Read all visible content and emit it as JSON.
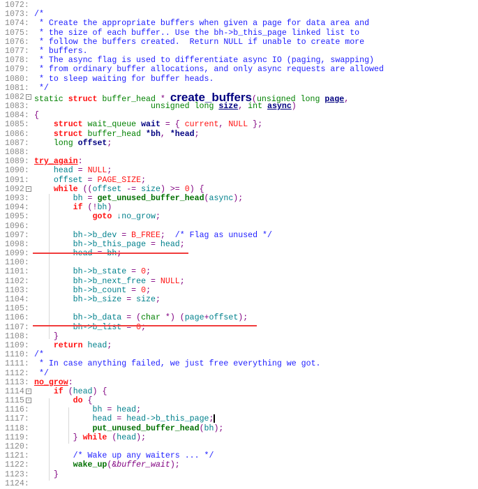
{
  "editor": {
    "fold_icon": "minus-box-icon",
    "lines": [
      {
        "n": "1072:",
        "tokens": []
      },
      {
        "n": "1073:",
        "tokens": [
          {
            "s": "c",
            "t": "/*"
          }
        ]
      },
      {
        "n": "1074:",
        "tokens": [
          {
            "s": "c",
            "t": " * Create the appropriate buffers when given a page for data area and"
          }
        ]
      },
      {
        "n": "1075:",
        "tokens": [
          {
            "s": "c",
            "t": " * the size of each buffer.. Use the bh->b_this_page linked list to"
          }
        ]
      },
      {
        "n": "1076:",
        "tokens": [
          {
            "s": "c",
            "t": " * follow the buffers created.  Return NULL if unable to create more"
          }
        ]
      },
      {
        "n": "1077:",
        "tokens": [
          {
            "s": "c",
            "t": " * buffers."
          }
        ]
      },
      {
        "n": "1078:",
        "tokens": [
          {
            "s": "c",
            "t": " * The async flag is used to differentiate async IO (paging, swapping)"
          }
        ]
      },
      {
        "n": "1079:",
        "tokens": [
          {
            "s": "c",
            "t": " * from ordinary buffer allocations, and only async requests are allowed"
          }
        ]
      },
      {
        "n": "1080:",
        "tokens": [
          {
            "s": "c",
            "t": " * to sleep waiting for buffer heads."
          }
        ]
      },
      {
        "n": "1081:",
        "tokens": [
          {
            "s": "c",
            "t": " */"
          }
        ]
      },
      {
        "n": "1082",
        "fold": true,
        "tokens": [
          {
            "s": "t",
            "t": "static "
          },
          {
            "s": "k",
            "t": "struct "
          },
          {
            "s": "t",
            "t": "buffer_head "
          },
          {
            "s": "p",
            "t": "* "
          },
          {
            "s": "big",
            "t": "create_buffers"
          },
          {
            "s": "p",
            "t": "("
          },
          {
            "s": "t",
            "t": "unsigned long "
          },
          {
            "s": "u",
            "t": "page"
          },
          {
            "s": "p",
            "t": ","
          }
        ]
      },
      {
        "n": "1083:",
        "tokens": [
          {
            "s": "t",
            "t": "                        unsigned long "
          },
          {
            "s": "u",
            "t": "size"
          },
          {
            "s": "p",
            "t": ", "
          },
          {
            "s": "t",
            "t": "int "
          },
          {
            "s": "u",
            "t": "async"
          },
          {
            "s": "p",
            "t": ")"
          }
        ]
      },
      {
        "n": "1084:",
        "tokens": [
          {
            "s": "p",
            "t": "{"
          }
        ]
      },
      {
        "n": "1085:",
        "tokens": [
          {
            "s": "p",
            "t": "    "
          },
          {
            "s": "k",
            "t": "struct "
          },
          {
            "s": "t",
            "t": "wait_queue "
          },
          {
            "s": "b",
            "t": "wait"
          },
          {
            "s": "p",
            "t": " = { "
          },
          {
            "s": "n",
            "t": "current"
          },
          {
            "s": "p",
            "t": ", "
          },
          {
            "s": "n",
            "t": "NULL"
          },
          {
            "s": "p",
            "t": " };"
          }
        ]
      },
      {
        "n": "1086:",
        "tokens": [
          {
            "s": "p",
            "t": "    "
          },
          {
            "s": "k",
            "t": "struct "
          },
          {
            "s": "t",
            "t": "buffer_head "
          },
          {
            "s": "b",
            "t": "*bh"
          },
          {
            "s": "p",
            "t": ", "
          },
          {
            "s": "b",
            "t": "*head"
          },
          {
            "s": "p",
            "t": ";"
          }
        ]
      },
      {
        "n": "1087:",
        "tokens": [
          {
            "s": "p",
            "t": "    "
          },
          {
            "s": "t",
            "t": "long "
          },
          {
            "s": "b",
            "t": "offset"
          },
          {
            "s": "p",
            "t": ";"
          }
        ]
      },
      {
        "n": "1088:",
        "tokens": []
      },
      {
        "n": "1089:",
        "tokens": [
          {
            "s": "l",
            "t": "try_again"
          },
          {
            "s": "p",
            "t": ":"
          }
        ]
      },
      {
        "n": "1090:",
        "tokens": [
          {
            "s": "p",
            "t": "    "
          },
          {
            "s": "i",
            "t": "head "
          },
          {
            "s": "p",
            "t": "= "
          },
          {
            "s": "n",
            "t": "NULL"
          },
          {
            "s": "p",
            "t": ";"
          }
        ]
      },
      {
        "n": "1091:",
        "tokens": [
          {
            "s": "p",
            "t": "    "
          },
          {
            "s": "i",
            "t": "offset "
          },
          {
            "s": "p",
            "t": "= "
          },
          {
            "s": "n",
            "t": "PAGE_SIZE"
          },
          {
            "s": "p",
            "t": ";"
          }
        ]
      },
      {
        "n": "1092",
        "fold": true,
        "tokens": [
          {
            "s": "p",
            "t": "    "
          },
          {
            "s": "k",
            "t": "while "
          },
          {
            "s": "p",
            "t": "(("
          },
          {
            "s": "i",
            "t": "offset "
          },
          {
            "s": "p",
            "t": "-= "
          },
          {
            "s": "i",
            "t": "size"
          },
          {
            "s": "p",
            "t": ") >= "
          },
          {
            "s": "n",
            "t": "0"
          },
          {
            "s": "p",
            "t": ") {"
          }
        ]
      },
      {
        "n": "1093:",
        "tokens": [
          {
            "s": "p",
            "t": "        "
          },
          {
            "s": "i",
            "t": "bh "
          },
          {
            "s": "p",
            "t": "= "
          },
          {
            "s": "f",
            "t": "get_unused_buffer_head"
          },
          {
            "s": "p",
            "t": "("
          },
          {
            "s": "i",
            "t": "async"
          },
          {
            "s": "p",
            "t": ");"
          }
        ]
      },
      {
        "n": "1094:",
        "tokens": [
          {
            "s": "p",
            "t": "        "
          },
          {
            "s": "k",
            "t": "if "
          },
          {
            "s": "p",
            "t": "(!"
          },
          {
            "s": "i",
            "t": "bh"
          },
          {
            "s": "p",
            "t": ")"
          }
        ]
      },
      {
        "n": "1095:",
        "tokens": [
          {
            "s": "p",
            "t": "            "
          },
          {
            "s": "k",
            "t": "goto "
          },
          {
            "s": "i",
            "t": "↓no_grow"
          },
          {
            "s": "p",
            "t": ";"
          }
        ]
      },
      {
        "n": "1096:",
        "tokens": []
      },
      {
        "n": "1097:",
        "tokens": [
          {
            "s": "p",
            "t": "        "
          },
          {
            "s": "i",
            "t": "bh->b_dev "
          },
          {
            "s": "p",
            "t": "= "
          },
          {
            "s": "n",
            "t": "B_FREE"
          },
          {
            "s": "p",
            "t": ";  "
          },
          {
            "s": "c",
            "t": "/* Flag as unused */"
          }
        ]
      },
      {
        "n": "1098:",
        "tokens": [
          {
            "s": "p",
            "t": "        "
          },
          {
            "s": "i",
            "t": "bh->b_this_page "
          },
          {
            "s": "p",
            "t": "= "
          },
          {
            "s": "i",
            "t": "head"
          },
          {
            "s": "p",
            "t": ";"
          }
        ]
      },
      {
        "n": "1099:",
        "tokens": [
          {
            "s": "p",
            "t": "        "
          },
          {
            "s": "i",
            "t": "head "
          },
          {
            "s": "p",
            "t": "= "
          },
          {
            "s": "i",
            "t": "bh"
          },
          {
            "s": "p",
            "t": ";"
          }
        ]
      },
      {
        "n": "1100:",
        "tokens": []
      },
      {
        "n": "1101:",
        "tokens": [
          {
            "s": "p",
            "t": "        "
          },
          {
            "s": "i",
            "t": "bh->b_state "
          },
          {
            "s": "p",
            "t": "= "
          },
          {
            "s": "n",
            "t": "0"
          },
          {
            "s": "p",
            "t": ";"
          }
        ]
      },
      {
        "n": "1102:",
        "tokens": [
          {
            "s": "p",
            "t": "        "
          },
          {
            "s": "i",
            "t": "bh->b_next_free "
          },
          {
            "s": "p",
            "t": "= "
          },
          {
            "s": "n",
            "t": "NULL"
          },
          {
            "s": "p",
            "t": ";"
          }
        ]
      },
      {
        "n": "1103:",
        "tokens": [
          {
            "s": "p",
            "t": "        "
          },
          {
            "s": "i",
            "t": "bh->b_count "
          },
          {
            "s": "p",
            "t": "= "
          },
          {
            "s": "n",
            "t": "0"
          },
          {
            "s": "p",
            "t": ";"
          }
        ]
      },
      {
        "n": "1104:",
        "tokens": [
          {
            "s": "p",
            "t": "        "
          },
          {
            "s": "i",
            "t": "bh->b_size "
          },
          {
            "s": "p",
            "t": "= "
          },
          {
            "s": "i",
            "t": "size"
          },
          {
            "s": "p",
            "t": ";"
          }
        ]
      },
      {
        "n": "1105:",
        "tokens": []
      },
      {
        "n": "1106:",
        "tokens": [
          {
            "s": "p",
            "t": "        "
          },
          {
            "s": "i",
            "t": "bh->b_data "
          },
          {
            "s": "p",
            "t": "= ("
          },
          {
            "s": "t",
            "t": "char "
          },
          {
            "s": "p",
            "t": "*) ("
          },
          {
            "s": "i",
            "t": "page"
          },
          {
            "s": "p",
            "t": "+"
          },
          {
            "s": "i",
            "t": "offset"
          },
          {
            "s": "p",
            "t": ");"
          }
        ]
      },
      {
        "n": "1107:",
        "tokens": [
          {
            "s": "p",
            "t": "        "
          },
          {
            "s": "i",
            "t": "bh->b_list "
          },
          {
            "s": "p",
            "t": "= "
          },
          {
            "s": "n",
            "t": "0"
          },
          {
            "s": "p",
            "t": ";"
          }
        ]
      },
      {
        "n": "1108:",
        "tokens": [
          {
            "s": "p",
            "t": "    }"
          }
        ]
      },
      {
        "n": "1109:",
        "tokens": [
          {
            "s": "p",
            "t": "    "
          },
          {
            "s": "k",
            "t": "return "
          },
          {
            "s": "i",
            "t": "head"
          },
          {
            "s": "p",
            "t": ";"
          }
        ]
      },
      {
        "n": "1110:",
        "tokens": [
          {
            "s": "c",
            "t": "/*"
          }
        ]
      },
      {
        "n": "1111:",
        "tokens": [
          {
            "s": "c",
            "t": " * In case anything failed, we just free everything we got."
          }
        ]
      },
      {
        "n": "1112:",
        "tokens": [
          {
            "s": "c",
            "t": " */"
          }
        ]
      },
      {
        "n": "1113:",
        "tokens": [
          {
            "s": "l",
            "t": "no_grow"
          },
          {
            "s": "p",
            "t": ":"
          }
        ]
      },
      {
        "n": "1114",
        "fold": true,
        "tokens": [
          {
            "s": "p",
            "t": "    "
          },
          {
            "s": "k",
            "t": "if "
          },
          {
            "s": "p",
            "t": "("
          },
          {
            "s": "i",
            "t": "head"
          },
          {
            "s": "p",
            "t": ") {"
          }
        ]
      },
      {
        "n": "1115",
        "fold": true,
        "tokens": [
          {
            "s": "p",
            "t": "        "
          },
          {
            "s": "k",
            "t": "do "
          },
          {
            "s": "p",
            "t": "{"
          }
        ]
      },
      {
        "n": "1116:",
        "tokens": [
          {
            "s": "p",
            "t": "            "
          },
          {
            "s": "i",
            "t": "bh "
          },
          {
            "s": "p",
            "t": "= "
          },
          {
            "s": "i",
            "t": "head"
          },
          {
            "s": "p",
            "t": ";"
          }
        ]
      },
      {
        "n": "1117:",
        "cursor": true,
        "tokens": [
          {
            "s": "p",
            "t": "            "
          },
          {
            "s": "i",
            "t": "head "
          },
          {
            "s": "p",
            "t": "= "
          },
          {
            "s": "i",
            "t": "head->b_this_page"
          },
          {
            "s": "p",
            "t": ";"
          }
        ]
      },
      {
        "n": "1118:",
        "tokens": [
          {
            "s": "p",
            "t": "            "
          },
          {
            "s": "f",
            "t": "put_unused_buffer_head"
          },
          {
            "s": "p",
            "t": "("
          },
          {
            "s": "i",
            "t": "bh"
          },
          {
            "s": "p",
            "t": ");"
          }
        ]
      },
      {
        "n": "1119:",
        "tokens": [
          {
            "s": "p",
            "t": "        } "
          },
          {
            "s": "k",
            "t": "while "
          },
          {
            "s": "p",
            "t": "("
          },
          {
            "s": "i",
            "t": "head"
          },
          {
            "s": "p",
            "t": ");"
          }
        ]
      },
      {
        "n": "1120:",
        "tokens": []
      },
      {
        "n": "1121:",
        "tokens": [
          {
            "s": "p",
            "t": "        "
          },
          {
            "s": "c",
            "t": "/* Wake up any waiters ... */"
          }
        ]
      },
      {
        "n": "1122:",
        "tokens": [
          {
            "s": "p",
            "t": "        "
          },
          {
            "s": "f",
            "t": "wake_up"
          },
          {
            "s": "p",
            "t": "(&"
          },
          {
            "s": "it",
            "t": "buffer_wait"
          },
          {
            "s": "p",
            "t": ");"
          }
        ]
      },
      {
        "n": "1123:",
        "tokens": [
          {
            "s": "p",
            "t": "    }"
          }
        ]
      },
      {
        "n": "1124:",
        "tokens": []
      }
    ]
  },
  "annotations": {
    "underline_color": "#f03c3c"
  }
}
